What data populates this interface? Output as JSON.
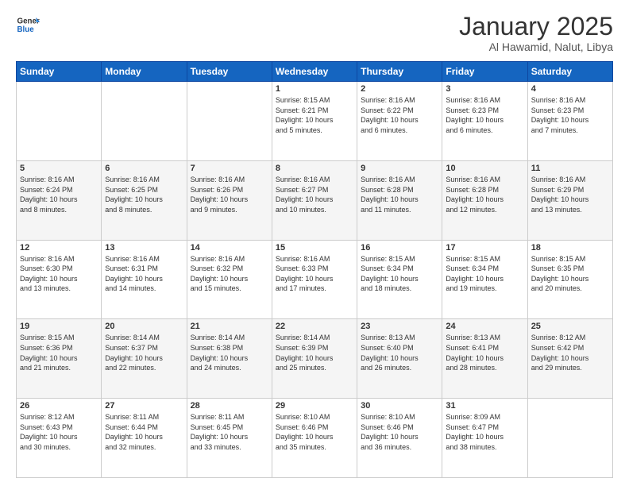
{
  "logo": {
    "line1": "General",
    "line2": "Blue"
  },
  "title": "January 2025",
  "location": "Al Hawamid, Nalut, Libya",
  "days_of_week": [
    "Sunday",
    "Monday",
    "Tuesday",
    "Wednesday",
    "Thursday",
    "Friday",
    "Saturday"
  ],
  "weeks": [
    [
      {
        "day": "",
        "info": ""
      },
      {
        "day": "",
        "info": ""
      },
      {
        "day": "",
        "info": ""
      },
      {
        "day": "1",
        "info": "Sunrise: 8:15 AM\nSunset: 6:21 PM\nDaylight: 10 hours\nand 5 minutes."
      },
      {
        "day": "2",
        "info": "Sunrise: 8:16 AM\nSunset: 6:22 PM\nDaylight: 10 hours\nand 6 minutes."
      },
      {
        "day": "3",
        "info": "Sunrise: 8:16 AM\nSunset: 6:23 PM\nDaylight: 10 hours\nand 6 minutes."
      },
      {
        "day": "4",
        "info": "Sunrise: 8:16 AM\nSunset: 6:23 PM\nDaylight: 10 hours\nand 7 minutes."
      }
    ],
    [
      {
        "day": "5",
        "info": "Sunrise: 8:16 AM\nSunset: 6:24 PM\nDaylight: 10 hours\nand 8 minutes."
      },
      {
        "day": "6",
        "info": "Sunrise: 8:16 AM\nSunset: 6:25 PM\nDaylight: 10 hours\nand 8 minutes."
      },
      {
        "day": "7",
        "info": "Sunrise: 8:16 AM\nSunset: 6:26 PM\nDaylight: 10 hours\nand 9 minutes."
      },
      {
        "day": "8",
        "info": "Sunrise: 8:16 AM\nSunset: 6:27 PM\nDaylight: 10 hours\nand 10 minutes."
      },
      {
        "day": "9",
        "info": "Sunrise: 8:16 AM\nSunset: 6:28 PM\nDaylight: 10 hours\nand 11 minutes."
      },
      {
        "day": "10",
        "info": "Sunrise: 8:16 AM\nSunset: 6:28 PM\nDaylight: 10 hours\nand 12 minutes."
      },
      {
        "day": "11",
        "info": "Sunrise: 8:16 AM\nSunset: 6:29 PM\nDaylight: 10 hours\nand 13 minutes."
      }
    ],
    [
      {
        "day": "12",
        "info": "Sunrise: 8:16 AM\nSunset: 6:30 PM\nDaylight: 10 hours\nand 13 minutes."
      },
      {
        "day": "13",
        "info": "Sunrise: 8:16 AM\nSunset: 6:31 PM\nDaylight: 10 hours\nand 14 minutes."
      },
      {
        "day": "14",
        "info": "Sunrise: 8:16 AM\nSunset: 6:32 PM\nDaylight: 10 hours\nand 15 minutes."
      },
      {
        "day": "15",
        "info": "Sunrise: 8:16 AM\nSunset: 6:33 PM\nDaylight: 10 hours\nand 17 minutes."
      },
      {
        "day": "16",
        "info": "Sunrise: 8:15 AM\nSunset: 6:34 PM\nDaylight: 10 hours\nand 18 minutes."
      },
      {
        "day": "17",
        "info": "Sunrise: 8:15 AM\nSunset: 6:34 PM\nDaylight: 10 hours\nand 19 minutes."
      },
      {
        "day": "18",
        "info": "Sunrise: 8:15 AM\nSunset: 6:35 PM\nDaylight: 10 hours\nand 20 minutes."
      }
    ],
    [
      {
        "day": "19",
        "info": "Sunrise: 8:15 AM\nSunset: 6:36 PM\nDaylight: 10 hours\nand 21 minutes."
      },
      {
        "day": "20",
        "info": "Sunrise: 8:14 AM\nSunset: 6:37 PM\nDaylight: 10 hours\nand 22 minutes."
      },
      {
        "day": "21",
        "info": "Sunrise: 8:14 AM\nSunset: 6:38 PM\nDaylight: 10 hours\nand 24 minutes."
      },
      {
        "day": "22",
        "info": "Sunrise: 8:14 AM\nSunset: 6:39 PM\nDaylight: 10 hours\nand 25 minutes."
      },
      {
        "day": "23",
        "info": "Sunrise: 8:13 AM\nSunset: 6:40 PM\nDaylight: 10 hours\nand 26 minutes."
      },
      {
        "day": "24",
        "info": "Sunrise: 8:13 AM\nSunset: 6:41 PM\nDaylight: 10 hours\nand 28 minutes."
      },
      {
        "day": "25",
        "info": "Sunrise: 8:12 AM\nSunset: 6:42 PM\nDaylight: 10 hours\nand 29 minutes."
      }
    ],
    [
      {
        "day": "26",
        "info": "Sunrise: 8:12 AM\nSunset: 6:43 PM\nDaylight: 10 hours\nand 30 minutes."
      },
      {
        "day": "27",
        "info": "Sunrise: 8:11 AM\nSunset: 6:44 PM\nDaylight: 10 hours\nand 32 minutes."
      },
      {
        "day": "28",
        "info": "Sunrise: 8:11 AM\nSunset: 6:45 PM\nDaylight: 10 hours\nand 33 minutes."
      },
      {
        "day": "29",
        "info": "Sunrise: 8:10 AM\nSunset: 6:46 PM\nDaylight: 10 hours\nand 35 minutes."
      },
      {
        "day": "30",
        "info": "Sunrise: 8:10 AM\nSunset: 6:46 PM\nDaylight: 10 hours\nand 36 minutes."
      },
      {
        "day": "31",
        "info": "Sunrise: 8:09 AM\nSunset: 6:47 PM\nDaylight: 10 hours\nand 38 minutes."
      },
      {
        "day": "",
        "info": ""
      }
    ]
  ]
}
